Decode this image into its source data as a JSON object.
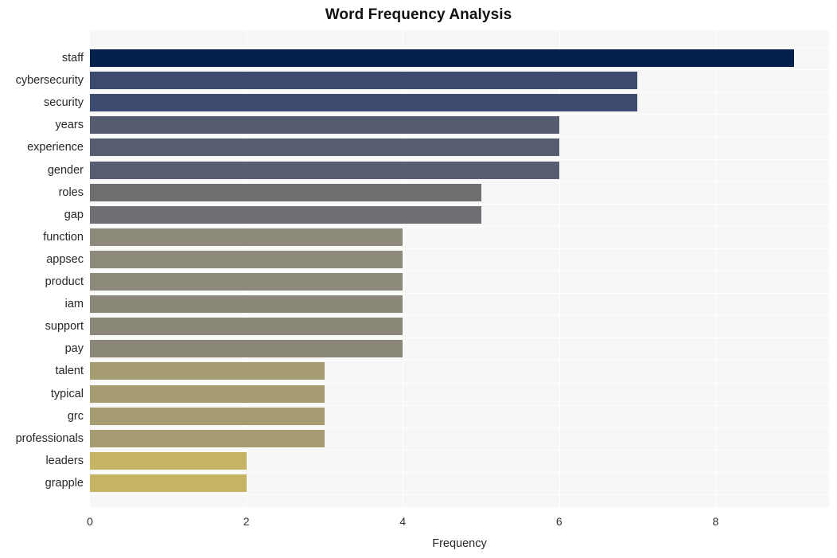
{
  "chart_data": {
    "type": "bar",
    "orientation": "horizontal",
    "title": "Word Frequency Analysis",
    "xlabel": "Frequency",
    "ylabel": "",
    "categories": [
      "staff",
      "cybersecurity",
      "security",
      "years",
      "experience",
      "gender",
      "roles",
      "gap",
      "function",
      "appsec",
      "product",
      "iam",
      "support",
      "pay",
      "talent",
      "typical",
      "grc",
      "professionals",
      "leaders",
      "grapple"
    ],
    "values": [
      9,
      7,
      7,
      6,
      6,
      6,
      5,
      5,
      4,
      4,
      4,
      4,
      4,
      4,
      3,
      3,
      3,
      3,
      2,
      2
    ],
    "bar_colors": [
      "#04214b",
      "#3c4a6e",
      "#3e4b70",
      "#565c70",
      "#575d71",
      "#585e72",
      "#6e6f71",
      "#6f7073",
      "#8d8a7b",
      "#8d8a7b",
      "#8d8a7b",
      "#8b887a",
      "#8a8779",
      "#8a8779",
      "#a69c72",
      "#a69c72",
      "#a69c72",
      "#a69c72",
      "#c4b464",
      "#c4b464"
    ],
    "xlim": [
      0,
      9.45
    ],
    "xticks": [
      0,
      2,
      4,
      6,
      8
    ],
    "xtick_labels": [
      "0",
      "2",
      "4",
      "6",
      "8"
    ],
    "grid": true,
    "legend": false,
    "plot_background": "#f7f7f8",
    "figure_background": "#ffffff"
  }
}
